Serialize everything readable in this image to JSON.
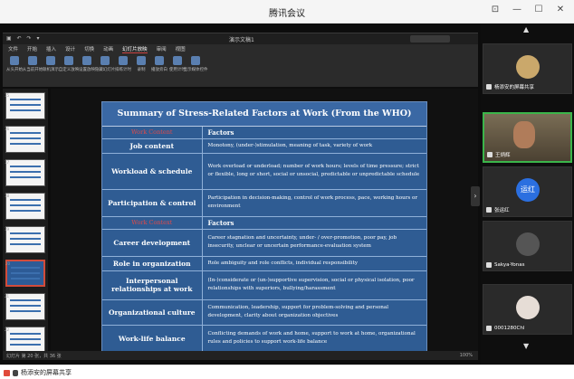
{
  "window": {
    "title": "腾讯会议",
    "ctrl_pin": "⊡",
    "ctrl_min": "—",
    "ctrl_max": "☐",
    "ctrl_close": "✕"
  },
  "ppt": {
    "doc_name": "演示文稿1",
    "menu_tabs": [
      "文件",
      "开始",
      "插入",
      "设计",
      "切换",
      "动画",
      "幻灯片放映",
      "审阅",
      "视图"
    ],
    "active_tab": "幻灯片放映",
    "tools": [
      "从头开始",
      "从当前开始",
      "联机演示",
      "自定义放映",
      "设置放映",
      "隐藏幻灯片",
      "排练计时",
      "录制",
      "播放旁白",
      "使用计时",
      "显示媒体控件"
    ],
    "thumb_numbers": [
      "15",
      "16",
      "17",
      "18",
      "19",
      "20",
      "21",
      "22"
    ],
    "status_left": "幻灯片 第 20 张，共 36 张",
    "status_right": "100%"
  },
  "slide": {
    "title": "Summary of Stress-Related Factors at Work  (From the WHO)",
    "section1": {
      "label": "Work Content",
      "right": "Factors"
    },
    "section2": {
      "label": "Work Context",
      "right": "Factors"
    },
    "rows1": [
      {
        "k": "Job content",
        "v": "Monotony, (under-)stimulation, meaning of task, variety of work"
      },
      {
        "k": "Workload & schedule",
        "v": "Work overload or underload; number of work hours; levels of time pressure; strict or flexible, long or short, social or unsocial, predictable or unpredictable schedule"
      },
      {
        "k": "Participation & control",
        "v": "Participation in decision-making, control of work process, pace, working hours or environment"
      }
    ],
    "rows2": [
      {
        "k": "Career development",
        "v": "Career stagnation and uncertainty, under- / over-promotion, poor pay, job insecurity, unclear or uncertain performance-evaluation system"
      },
      {
        "k": "Role in organization",
        "v": "Role ambiguity and role conflicts, individual responsibility"
      },
      {
        "k": "Interpersonal relationships at work",
        "v": "(In-)considerate or (un-)supportive supervision, social or physical isolation, poor relationships with superiors, bullying/harassment"
      },
      {
        "k": "Organizational culture",
        "v": "Communication, leadership, support for problem-solving and personal development, clarity about organization objectives"
      },
      {
        "k": "Work-life balance",
        "v": "Conflicting demands of work and home, support to work at home, organizational rules and policies to support work-life balance"
      }
    ]
  },
  "participants": [
    {
      "name": "杨添安的屏幕共享",
      "type": "avatar"
    },
    {
      "name": "王炳辉",
      "type": "video"
    },
    {
      "name": "张运红",
      "type": "text",
      "avatar_text": "运红"
    },
    {
      "name": "Sakya-Yonas",
      "type": "gray"
    },
    {
      "name": "0001280Chl",
      "type": "girl"
    }
  ],
  "bottom": {
    "sharing": "杨添安的屏幕共享"
  }
}
